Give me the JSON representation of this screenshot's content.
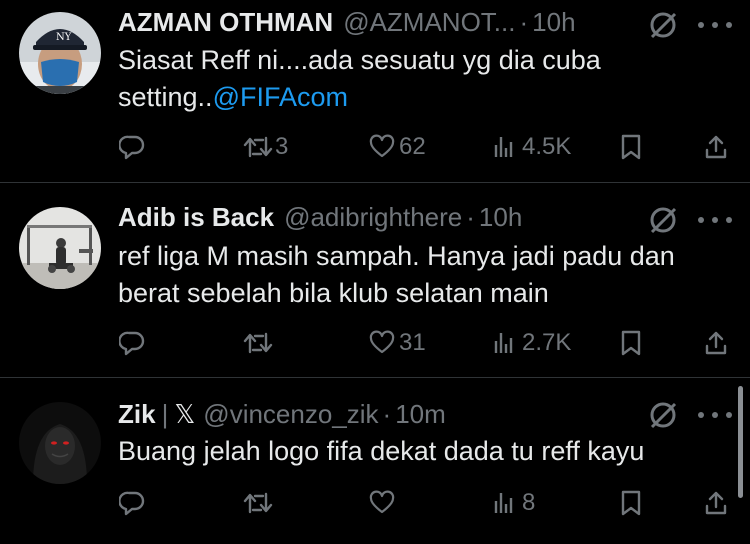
{
  "tweets": [
    {
      "name": "AZMAN OTHMAN",
      "handle": "@AZMANOT...",
      "sep": "·",
      "time": "10h",
      "text_before": "Siasat Reff ni....ada sesuatu yg dia cuba setting..",
      "mention": "@FIFAcom",
      "reply_count": "",
      "retweet_count": "3",
      "like_count": "62",
      "view_count": "4.5K"
    },
    {
      "name": "Adib is Back",
      "handle": "@adibrighthere",
      "sep": "·",
      "time": "10h",
      "text_before": "ref liga M masih sampah. Hanya jadi padu dan berat sebelah bila klub selatan main",
      "mention": "",
      "reply_count": "",
      "retweet_count": "",
      "like_count": "31",
      "view_count": "2.7K"
    },
    {
      "name": "Zik",
      "name_separator": "|",
      "name_badge": "𝕏",
      "handle": "@vincenzo_zik",
      "sep": "·",
      "time": "10m",
      "text_before": "Buang jelah logo fifa dekat dada tu reff kayu",
      "mention": "",
      "reply_count": "",
      "retweet_count": "",
      "like_count": "",
      "view_count": "8"
    }
  ],
  "icons": {
    "reply": "reply-icon",
    "retweet": "retweet-icon",
    "like": "heart-icon",
    "views": "views-chart-icon",
    "bookmark": "bookmark-icon",
    "share": "share-icon",
    "grok": "grok-icon",
    "more": "more-dots-icon"
  },
  "colors": {
    "background": "#000000",
    "text": "#e7e9ea",
    "secondary": "#71767b",
    "link": "#1d9bf0",
    "divider": "#2f3336"
  }
}
